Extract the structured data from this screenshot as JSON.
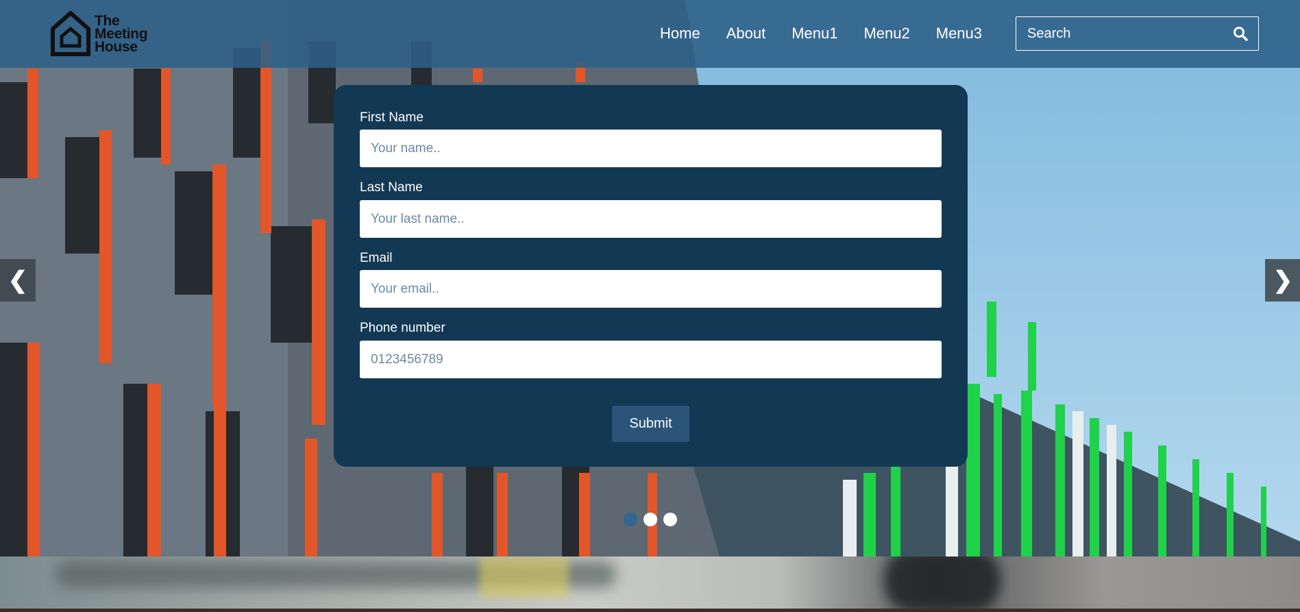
{
  "header": {
    "logo_lines": [
      "The",
      "Meeting",
      "House"
    ],
    "nav": [
      "Home",
      "About",
      "Menu1",
      "Menu2",
      "Menu3"
    ],
    "search_placeholder": "Search"
  },
  "form": {
    "fields": [
      {
        "label": "First Name",
        "placeholder": "Your name.."
      },
      {
        "label": "Last Name",
        "placeholder": "Your last name.."
      },
      {
        "label": "Email",
        "placeholder": "Your email.."
      },
      {
        "label": "Phone number",
        "placeholder": "0123456789"
      }
    ],
    "submit_label": "Submit"
  },
  "carousel": {
    "prev_symbol": "❮",
    "next_symbol": "❯",
    "slide_count": 3,
    "active_index": 0
  },
  "colors": {
    "header_bg": "#2d6087",
    "card_bg": "#133853",
    "submit_bg": "#2a5578",
    "active_dot": "#2f6790"
  }
}
